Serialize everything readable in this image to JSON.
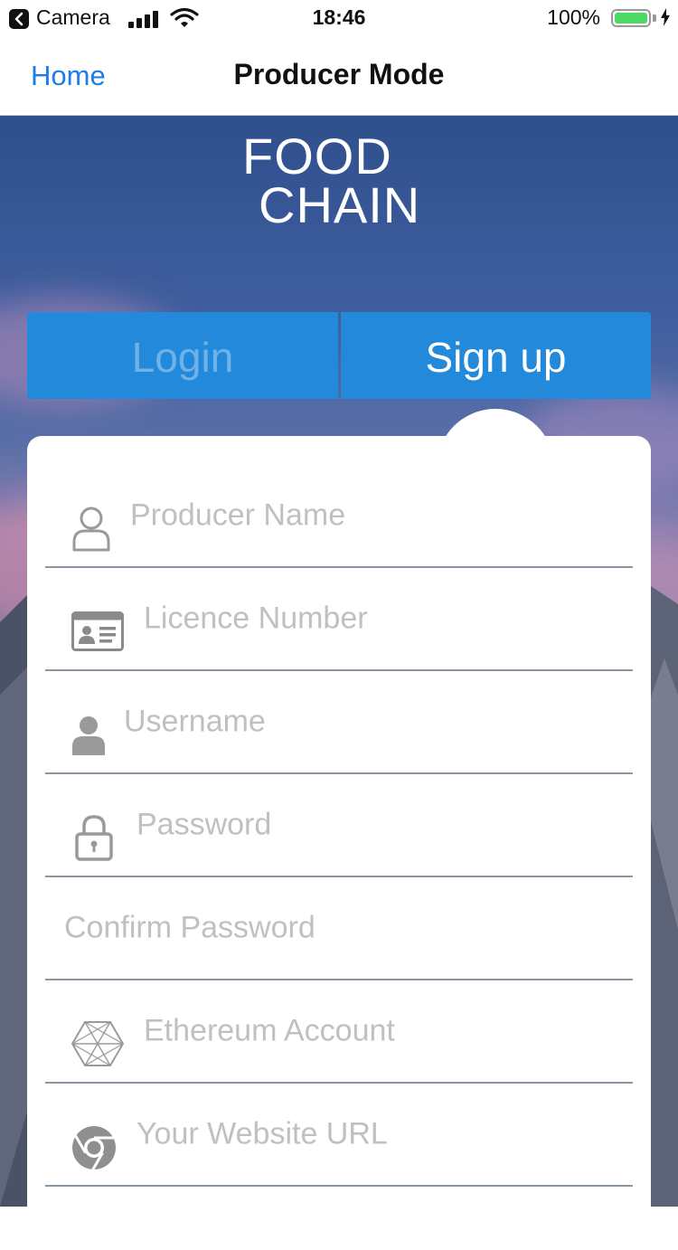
{
  "status_bar": {
    "back_app": "Camera",
    "time": "18:46",
    "battery": "100%"
  },
  "nav": {
    "back_label": "Home",
    "title": "Producer Mode"
  },
  "logo": {
    "line1": "FOOD",
    "line2": "CHAIN"
  },
  "tabs": {
    "login": "Login",
    "signup": "Sign up",
    "active": "signup"
  },
  "form": {
    "fields": [
      {
        "placeholder": "Producer Name",
        "icon": "user-outline-icon"
      },
      {
        "placeholder": "Licence Number",
        "icon": "id-card-icon"
      },
      {
        "placeholder": "Username",
        "icon": "user-filled-icon"
      },
      {
        "placeholder": "Password",
        "icon": "lock-icon"
      },
      {
        "placeholder": "Confirm Password",
        "icon": ""
      },
      {
        "placeholder": "Ethereum Account",
        "icon": "ethereum-icon"
      },
      {
        "placeholder": "Your Website URL",
        "icon": "chrome-icon"
      }
    ]
  },
  "colors": {
    "accent": "#2389db",
    "link": "#1b7ee6",
    "placeholder": "#c0c0c0",
    "divider": "#8a96a2"
  }
}
